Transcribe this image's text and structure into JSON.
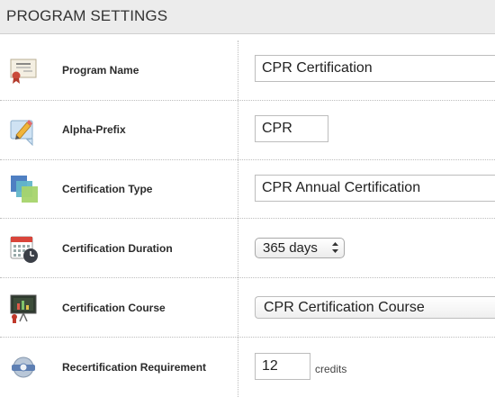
{
  "header": {
    "title": "PROGRAM SETTINGS"
  },
  "rows": [
    {
      "id": "program-name",
      "label": "Program Name",
      "value": "CPR Certification",
      "icon": "certificate-icon"
    },
    {
      "id": "alpha-prefix",
      "label": "Alpha-Prefix",
      "value": "CPR",
      "icon": "pencil-note-icon"
    },
    {
      "id": "certification-type",
      "label": "Certification Type",
      "value": "CPR Annual Certification",
      "icon": "stacked-squares-icon"
    },
    {
      "id": "certification-duration",
      "label": "Certification Duration",
      "value": "365 days",
      "icon": "calendar-clock-icon"
    },
    {
      "id": "certification-course",
      "label": "Certification Course",
      "value": "CPR Certification Course",
      "icon": "presentation-board-icon"
    },
    {
      "id": "recertification-requirement",
      "label": "Recertification Requirement",
      "value": "12",
      "unit": "credits",
      "icon": "globe-badge-icon"
    }
  ],
  "colors": {
    "header_bg": "#ececec",
    "border": "#bdbdbd",
    "label_text": "#2b2b2b"
  }
}
